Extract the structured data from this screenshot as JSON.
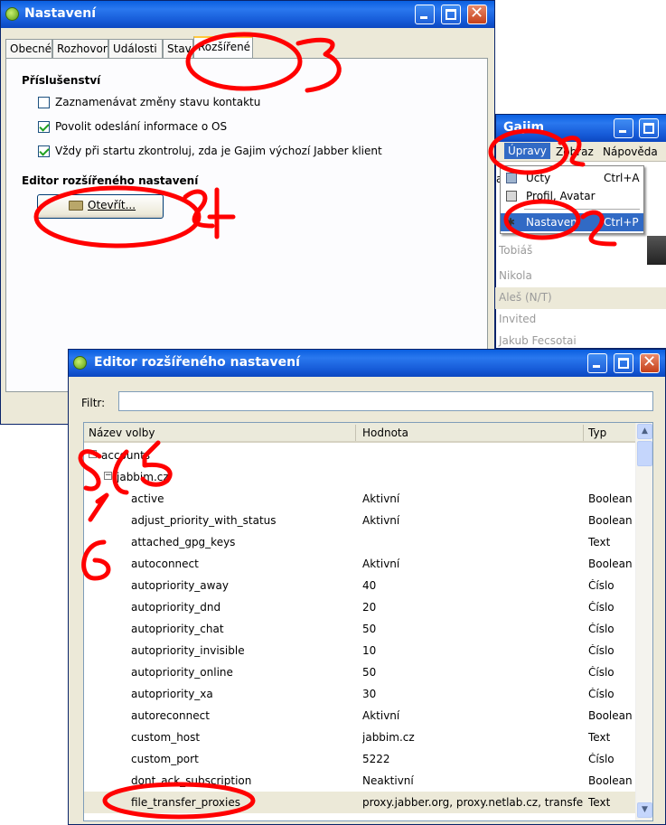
{
  "colors": {
    "accent": "#0a5fe0",
    "annotation": "#ff0000",
    "selection": "#316ac5"
  },
  "settings_window": {
    "title": "Nastavení",
    "tabs": [
      "Obecné",
      "Rozhovor",
      "Události",
      "Stav",
      "Rozšířené"
    ],
    "section_accessories": "Příslušenství",
    "checkboxes": [
      {
        "label": "Zaznamenávat změny stavu kontaktu",
        "checked": false
      },
      {
        "label": "Povolit odeslání informace o OS",
        "checked": true
      },
      {
        "label": "Vždy při startu zkontroluj, zda je Gajim výchozí Jabber klient",
        "checked": true
      }
    ],
    "section_editor": "Editor rozšířeného nastavení",
    "open_button": "Otevřít..."
  },
  "gajim_window": {
    "title": "Gajim",
    "menus": [
      "Úpravy",
      "Zobraz",
      "Nápověda"
    ],
    "left_char": "a",
    "dropdown": [
      {
        "label": "Účty",
        "shortcut": "Ctrl+A",
        "icon": "accounts-icon"
      },
      {
        "label": "Profil, Avatar",
        "shortcut": "",
        "icon": "profile-icon"
      },
      {
        "label": "Nastavení",
        "shortcut": "Ctrl+P",
        "icon": "preferences-icon"
      }
    ],
    "roster": [
      "Tobiáš",
      "Nikola",
      "Aleš (N/T)",
      "Invited",
      "Jakub Fecsotai"
    ]
  },
  "editor_window": {
    "title": "Editor rozšířeného nastavení",
    "filter_label": "Filtr:",
    "filter_value": "",
    "columns": [
      "Název volby",
      "Hodnota",
      "Typ"
    ],
    "rows": [
      {
        "name": "accounts",
        "value": "",
        "type": "",
        "level": 0,
        "expander": "⊟"
      },
      {
        "name": "jabbim.cz",
        "value": "",
        "type": "",
        "level": 1,
        "expander": "⊟"
      },
      {
        "name": "active",
        "value": "Aktivní",
        "type": "Boolean",
        "level": 2
      },
      {
        "name": "adjust_priority_with_status",
        "value": "Aktivní",
        "type": "Boolean",
        "level": 2
      },
      {
        "name": "attached_gpg_keys",
        "value": "",
        "type": "Text",
        "level": 2
      },
      {
        "name": "autoconnect",
        "value": "Aktivní",
        "type": "Boolean",
        "level": 2
      },
      {
        "name": "autopriority_away",
        "value": "40",
        "type": "Číslo",
        "level": 2
      },
      {
        "name": "autopriority_dnd",
        "value": "20",
        "type": "Číslo",
        "level": 2
      },
      {
        "name": "autopriority_chat",
        "value": "50",
        "type": "Číslo",
        "level": 2
      },
      {
        "name": "autopriority_invisible",
        "value": "10",
        "type": "Číslo",
        "level": 2
      },
      {
        "name": "autopriority_online",
        "value": "50",
        "type": "Číslo",
        "level": 2
      },
      {
        "name": "autopriority_xa",
        "value": "30",
        "type": "Číslo",
        "level": 2
      },
      {
        "name": "autoreconnect",
        "value": "Aktivní",
        "type": "Boolean",
        "level": 2
      },
      {
        "name": "custom_host",
        "value": "jabbim.cz",
        "type": "Text",
        "level": 2
      },
      {
        "name": "custom_port",
        "value": "5222",
        "type": "Číslo",
        "level": 2
      },
      {
        "name": "dont_ack_subscription",
        "value": "Neaktivní",
        "type": "Boolean",
        "level": 2
      },
      {
        "name": "file_transfer_proxies",
        "value": "proxy.jabber.org, proxy.netlab.cz, transfer.",
        "type": "Text",
        "level": 2,
        "highlight": true
      }
    ]
  },
  "annotations": [
    "1",
    "2",
    "3",
    "4",
    "5",
    "6"
  ]
}
